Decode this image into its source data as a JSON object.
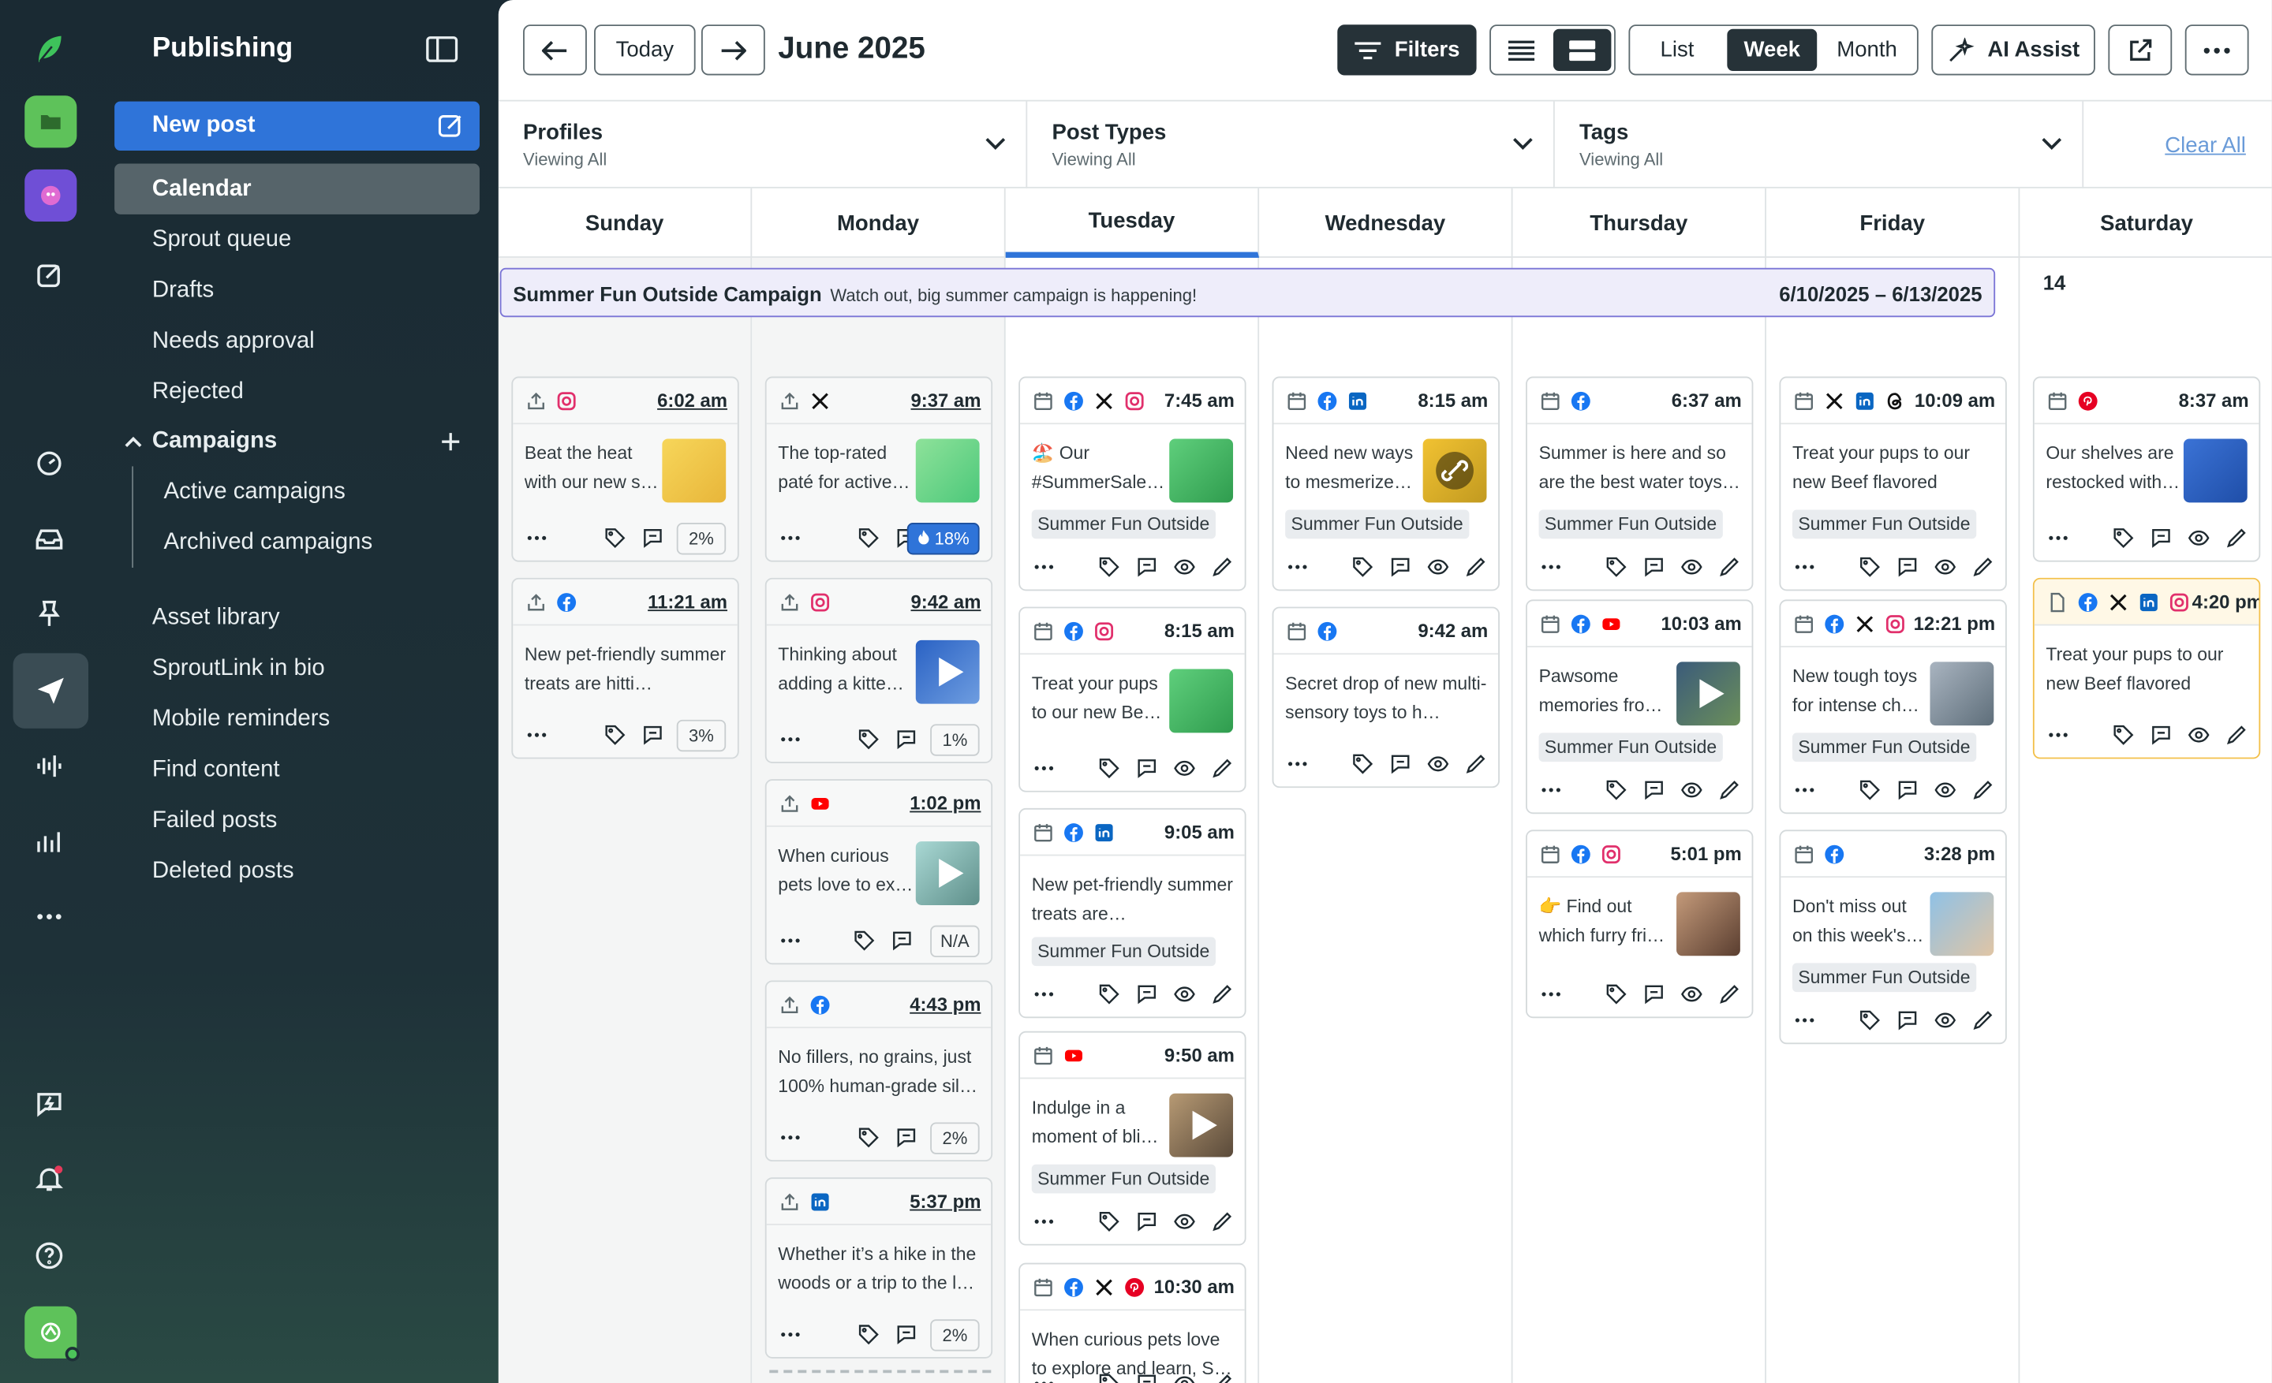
{
  "sidebar": {
    "title": "Publishing",
    "new_post": "New post",
    "items": [
      "Calendar",
      "Sprout queue",
      "Drafts",
      "Needs approval",
      "Rejected"
    ],
    "campaigns_header": "Campaigns",
    "campaign_items": [
      "Active campaigns",
      "Archived campaigns"
    ],
    "more_items": [
      "Asset library",
      "SproutLink in bio",
      "Mobile reminders",
      "Find content",
      "Failed posts",
      "Deleted posts"
    ]
  },
  "toolbar": {
    "today": "Today",
    "month": "June 2025",
    "filters": "Filters",
    "views": [
      "List",
      "Week",
      "Month"
    ],
    "active_view": "Week",
    "ai_assist": "AI Assist"
  },
  "filters": [
    {
      "label": "Profiles",
      "value": "Viewing All"
    },
    {
      "label": "Post Types",
      "value": "Viewing All"
    },
    {
      "label": "Tags",
      "value": "Viewing All"
    }
  ],
  "clear_all": "Clear All",
  "days": [
    "Sunday",
    "Monday",
    "Tuesday",
    "Wednesday",
    "Thursday",
    "Friday",
    "Saturday"
  ],
  "active_day": "Tuesday",
  "banner": {
    "title": "Summer Fun Outside Campaign",
    "desc": "Watch out, big summer campaign is happening!",
    "range": "6/10/2025 – 6/13/2025"
  },
  "saturday_date": "14",
  "campaign_tag": "Summer Fun Outside",
  "posts": {
    "sunday": [
      {
        "time": "6:02 am",
        "text": "Beat the heat with our new s…",
        "stat": "2%"
      },
      {
        "time": "11:21 am",
        "text": "New pet-friendly summer treats are hitti…",
        "stat": "3%"
      }
    ],
    "monday": [
      {
        "time": "9:37 am",
        "text": "The top-rated paté for active…",
        "stat": "18%"
      },
      {
        "time": "9:42 am",
        "text": "Thinking about adding a kitte…",
        "stat": "1%"
      },
      {
        "time": "1:02 pm",
        "text": "When curious pets love to ex…",
        "stat": "N/A"
      },
      {
        "time": "4:43 pm",
        "text": "No fillers, no grains, just 100% human-grade sil…",
        "stat": "2%"
      },
      {
        "time": "5:37 pm",
        "text": "Whether it’s a hike in the woods or a trip to the l…",
        "stat": "2%"
      }
    ],
    "tuesday": [
      {
        "time": "7:45 am",
        "text": "🏖️ Our #SummerSale…"
      },
      {
        "time": "8:15 am",
        "text": "Treat your pups to our new Be…"
      },
      {
        "time": "9:05 am",
        "text": "New pet-friendly summer treats are…"
      },
      {
        "time": "9:50 am",
        "text": "Indulge in a moment of bli…"
      },
      {
        "time": "10:30 am",
        "text": "When curious pets love to explore and learn, S…"
      }
    ],
    "wednesday": [
      {
        "time": "8:15 am",
        "text": "Need new ways to mesmerize…"
      },
      {
        "time": "9:42 am",
        "text": "Secret drop of new multi-sensory toys to h…"
      }
    ],
    "thursday": [
      {
        "time": "6:37 am",
        "text": "Summer is here and so are the best water toys…"
      },
      {
        "time": "10:03 am",
        "text": "Pawsome memories fro…"
      },
      {
        "time": "5:01 pm",
        "text": "👉 Find out which furry fri…"
      }
    ],
    "friday": [
      {
        "time": "10:09 am",
        "text": "Treat your pups to our new Beef flavored snac…"
      },
      {
        "time": "12:21 pm",
        "text": "New tough toys for intense ch…"
      },
      {
        "time": "3:28 pm",
        "text": "Don't miss out on this week's…"
      }
    ],
    "saturday": [
      {
        "time": "8:37 am",
        "text": "Our shelves are restocked with…"
      },
      {
        "time": "4:20 pm",
        "text": "Treat your pups to our new Beef flavored snac…"
      }
    ]
  },
  "colors": {
    "accent": "#2f74d9",
    "nav_bg": "#1c2b33",
    "banner": "#eeedfa",
    "draft": "#f3c04a"
  }
}
